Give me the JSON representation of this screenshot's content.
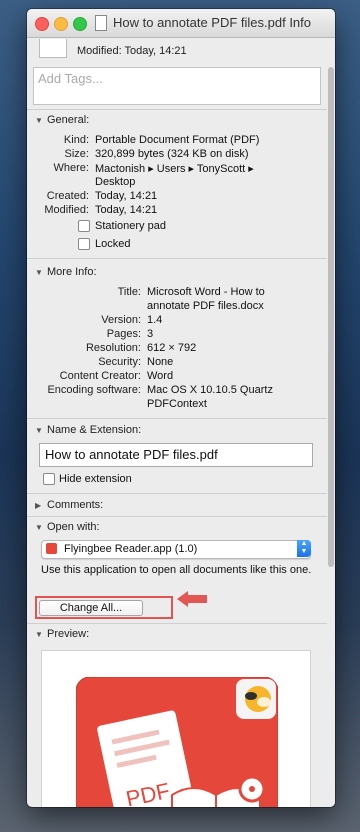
{
  "window": {
    "title": "How to annotate PDF files.pdf Info"
  },
  "top": {
    "modified": "Modified: Today, 14:21"
  },
  "tags": {
    "placeholder": "Add Tags..."
  },
  "general": {
    "header": "General:",
    "kind_k": "Kind:",
    "kind_v": "Portable Document Format (PDF)",
    "size_k": "Size:",
    "size_v": "320,899 bytes (324 KB on disk)",
    "where_k": "Where:",
    "where_v1": "Mactonish ▸ Users ▸ TonyScott ▸",
    "where_v2": "Desktop",
    "created_k": "Created:",
    "created_v": "Today, 14:21",
    "modified_k": "Modified:",
    "modified_v": "Today, 14:21",
    "stationery": "Stationery pad",
    "locked": "Locked"
  },
  "more_info": {
    "header": "More Info:",
    "title_k": "Title:",
    "title_v1": "Microsoft Word - How to",
    "title_v2": "annotate PDF files.docx",
    "version_k": "Version:",
    "version_v": "1.4",
    "pages_k": "Pages:",
    "pages_v": "3",
    "resolution_k": "Resolution:",
    "resolution_v": "612 × 792",
    "security_k": "Security:",
    "security_v": "None",
    "creator_k": "Content Creator:",
    "creator_v": "Word",
    "encoding_k": "Encoding software:",
    "encoding_v1": "Mac OS X 10.10.5 Quartz",
    "encoding_v2": "PDFContext"
  },
  "name_ext": {
    "header": "Name & Extension:",
    "filename": "How to annotate PDF files.pdf",
    "hide_ext": "Hide extension"
  },
  "comments": {
    "header": "Comments:"
  },
  "open_with": {
    "header": "Open with:",
    "app": "Flyingbee Reader.app (1.0)",
    "use_text": "Use this application to open all documents like this one.",
    "change_all": "Change All..."
  },
  "preview": {
    "header": "Preview:",
    "pdf_label": "PDF"
  },
  "colors": {
    "highlight": "#e05552",
    "accent_blue": "#1874e8",
    "pdf_red": "#e5473a"
  },
  "icons": {
    "disclosure_open": "▼",
    "disclosure_closed": "▶"
  }
}
